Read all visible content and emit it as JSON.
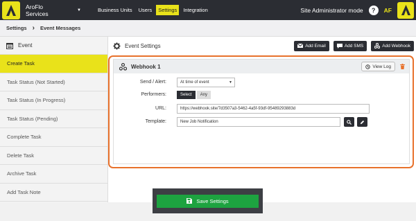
{
  "topbar": {
    "app_name": "AroFlo Services",
    "nav": [
      "Business Units",
      "Users",
      "Settings",
      "Integration"
    ],
    "active_nav": "Settings",
    "mode": "Site Administrator mode",
    "help": "?",
    "user": "AF"
  },
  "breadcrumb": {
    "root": "Settings",
    "current": "Event Messages"
  },
  "sidebar": {
    "title": "Event",
    "items": [
      {
        "label": "Create Task",
        "active": true
      },
      {
        "label": "Task Status (Not Started)"
      },
      {
        "label": "Task Status (In Progress)"
      },
      {
        "label": "Task Status (Pending)"
      },
      {
        "label": "Complete Task"
      },
      {
        "label": "Delete Task"
      },
      {
        "label": "Archive Task"
      },
      {
        "label": "Add Task Note"
      }
    ]
  },
  "main": {
    "title": "Event Settings",
    "buttons": {
      "email": "Add Email",
      "sms": "Add SMS",
      "webhook": "Add Webhook"
    }
  },
  "webhook": {
    "title": "Webhook 1",
    "view_log": "View Log",
    "send_label": "Send / Alert:",
    "send_value": "At time of event",
    "performers_label": "Performers:",
    "performers_select": "Select",
    "performers_any": "Any",
    "url_label": "URL:",
    "url_value": "https://webhook.site/7d3507a3-5462-4a5f-93df-95489293883d",
    "template_label": "Template:",
    "template_value": "New Job Notification"
  },
  "save_label": "Save Settings",
  "colors": {
    "accent": "#e9e21a",
    "dark": "#2b2d33",
    "highlight_border": "#e8712b",
    "save": "#1da340"
  }
}
